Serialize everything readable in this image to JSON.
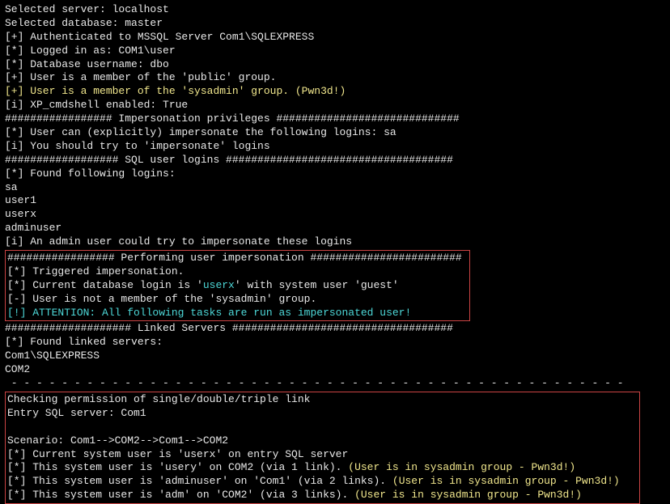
{
  "lines": {
    "l1": "Selected server: localhost",
    "l2": "Selected database: master",
    "l3": "[+] Authenticated to MSSQL Server Com1\\SQLEXPRESS",
    "l4": "[*] Logged in as: COM1\\user",
    "l5": "[*] Database username: dbo",
    "l6": "[+] User is a member of the 'public' group.",
    "l7": "[+] User is a member of the 'sysadmin' group. (Pwn3d!)",
    "l8": "[i] XP_cmdshell enabled: True",
    "l9": "################# Impersonation privileges #############################",
    "l10": "[*] User can (explicitly) impersonate the following logins: sa",
    "l11": "[i] You should try to 'impersonate' logins",
    "l12": "################## SQL user logins ####################################",
    "l13": "[*] Found following logins:",
    "l14": "sa",
    "l15": "user1",
    "l16": "userx",
    "l17": "adminuser",
    "l18": "[i] An admin user could try to impersonate these logins",
    "l19": "################# Performing user impersonation ########################",
    "l20": "[*] Triggered impersonation.",
    "l21a": "[*] Current database login is '",
    "l21b": "userx",
    "l21c": "' with system user 'guest'",
    "l22": "[-] User is not a member of the 'sysadmin' group.",
    "l23": "[!] ATTENTION: All following tasks are run as impersonated user!",
    "l24": "#################### Linked Servers ###################################",
    "l25": "[*] Found linked servers:",
    "l26": "Com1\\SQLEXPRESS",
    "l27": "COM2",
    "dashes": " - - - - - - - - - - - - - - - - - - - - - - - - - - - - - - - - - - - - - - - - - - - - - - - - -",
    "l29": "Checking permission of single/double/triple link",
    "l30": "Entry SQL server: Com1",
    "l31": "Scenario: Com1-->COM2-->Com1-->COM2",
    "l32": "[*] Current system user is 'userx' on entry SQL server",
    "l33a": "[*] This system user is 'usery' on COM2 (via 1 link). ",
    "l33b": "(User is in sysadmin group - Pwn3d!)",
    "l34a": "[*] This system user is 'adminuser' on 'Com1' (via 2 links). ",
    "l34b": "(User is in sysadmin group - Pwn3d!)",
    "l35a": "[*] This system user is 'adm' on 'COM2' (via 3 links). ",
    "l35b": "(User is in sysadmin group - Pwn3d!)"
  }
}
